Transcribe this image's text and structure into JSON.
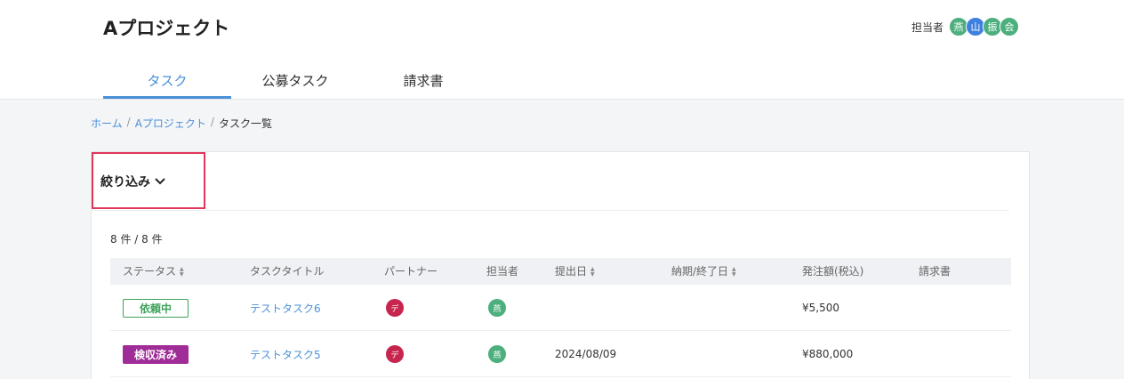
{
  "project": {
    "title": "Aプロジェクト"
  },
  "assignee": {
    "label": "担当者",
    "avatars": [
      {
        "char": "燕",
        "color": "#4caf7d"
      },
      {
        "char": "山",
        "color": "#3f7fe0"
      },
      {
        "char": "振",
        "color": "#4caf7d"
      },
      {
        "char": "会",
        "color": "#4caf7d"
      }
    ]
  },
  "tabs": [
    {
      "label": "タスク",
      "active": true
    },
    {
      "label": "公募タスク",
      "active": false
    },
    {
      "label": "請求書",
      "active": false
    }
  ],
  "breadcrumb": {
    "home": "ホーム",
    "project": "Aプロジェクト",
    "current": "タスク一覧",
    "sep": "/"
  },
  "filter": {
    "label": "絞り込み",
    "chevron": "chevron-down-icon"
  },
  "count": "8 件 / 8 件",
  "table": {
    "columns": [
      {
        "label": "ステータス",
        "sortable": true
      },
      {
        "label": "タスクタイトル",
        "sortable": false
      },
      {
        "label": "パートナー",
        "sortable": false
      },
      {
        "label": "担当者",
        "sortable": false
      },
      {
        "label": "提出日",
        "sortable": true
      },
      {
        "label": "納期/終了日",
        "sortable": true
      },
      {
        "label": "発注額(税込)",
        "sortable": false
      },
      {
        "label": "請求書",
        "sortable": false
      }
    ],
    "rows": [
      {
        "status": "依頼中",
        "status_style": "outline",
        "title": "テストタスク6",
        "partner": {
          "char": "デ",
          "color": "#c7254e"
        },
        "assignee": {
          "char": "燕",
          "color": "#4caf7d"
        },
        "submitted": "",
        "deadline": "",
        "amount": "¥5,500",
        "invoice": ""
      },
      {
        "status": "検収済み",
        "status_style": "filled",
        "title": "テストタスク5",
        "partner": {
          "char": "デ",
          "color": "#c7254e"
        },
        "assignee": {
          "char": "燕",
          "color": "#4caf7d"
        },
        "submitted": "2024/08/09",
        "deadline": "",
        "amount": "¥880,000",
        "invoice": ""
      }
    ]
  }
}
